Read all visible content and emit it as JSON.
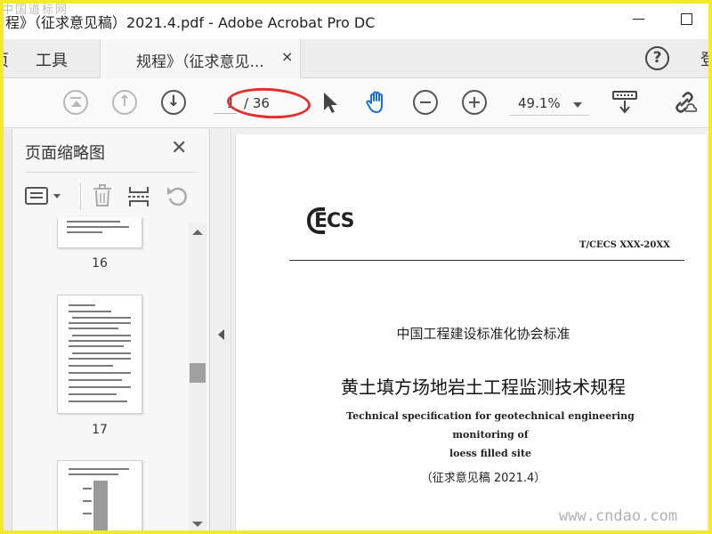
{
  "window": {
    "title": "程》（征求意见稿）2021.4.pdf - Adobe Acrobat Pro DC",
    "watermark_top": "中国道标网",
    "watermark_bottom": "www.cndao.com"
  },
  "tabs": {
    "home_partial": "页",
    "tools": "工具",
    "document": "规程》（征求意见...",
    "close": "×",
    "help": "?",
    "signin_partial": "登"
  },
  "toolbar": {
    "current_page": "1",
    "total_pages": "/ 36",
    "zoom": "49.1%"
  },
  "sidebar": {
    "title": "页面缩略图",
    "close": "✕",
    "thumbnails": [
      {
        "page": "16"
      },
      {
        "page": "17"
      }
    ]
  },
  "document": {
    "logo": "ECS",
    "standard_number": "T/CECS  XXX-20XX",
    "association": "中国工程建设标准化协会标准",
    "title_cn": "黄土填方场地岩土工程监测技术规程",
    "title_en_line1": "Technical specification for geotechnical engineering monitoring of",
    "title_en_line2": "loess filled site",
    "draft_note": "（征求意见稿 2021.4）"
  },
  "colors": {
    "annotation": "#e03030",
    "border": "#f2ea2b",
    "hand_tool": "#1f6fd1"
  }
}
